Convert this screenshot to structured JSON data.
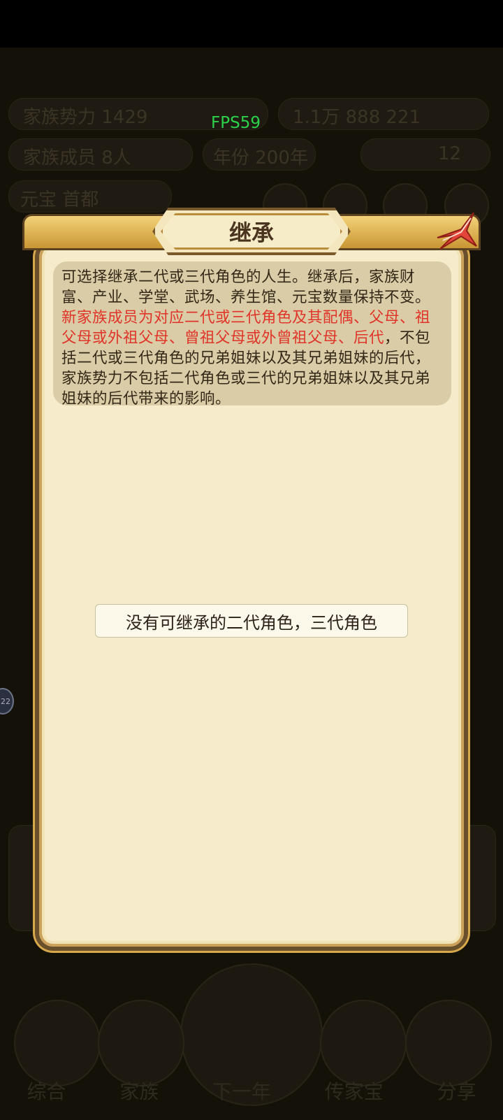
{
  "fps": "FPS59",
  "dialog": {
    "title": "继承",
    "description_normal_1": "可选择继承二代或三代角色的人生。继承后，家族财富、产业、学堂、武场、养生馆、元宝数量保持不变。",
    "description_red": "新家族成员为对应二代或三代角色及其配偶、父母、祖父母或外祖父母、曾祖父母或外曾祖父母、后代",
    "description_normal_2": "，不包括二代或三代角色的兄弟姐妹以及其兄弟姐妹的后代，家族势力不包括二代角色或三代的兄弟姐妹以及其兄弟姐妹的后代带来的影响。",
    "empty_message": "没有可继承的二代角色，三代角色"
  },
  "background": {
    "top_left_stat": "家族势力 1429",
    "top_right_stat": "1.1万 888 221",
    "row2_left": "家族成员 8人",
    "row2_mid": "年份 200年",
    "row2_right": "12",
    "row3_left": "元宝 首都"
  },
  "side_badge": "22",
  "bottom_tabs": [
    "综合",
    "家族",
    "下一年",
    "传家宝",
    "分享"
  ],
  "colors": {
    "accent_red": "#e03428",
    "dialog_bg": "#f6eccb",
    "frame_brown": "#6a4f2d",
    "fps_green": "#2bd24a"
  }
}
